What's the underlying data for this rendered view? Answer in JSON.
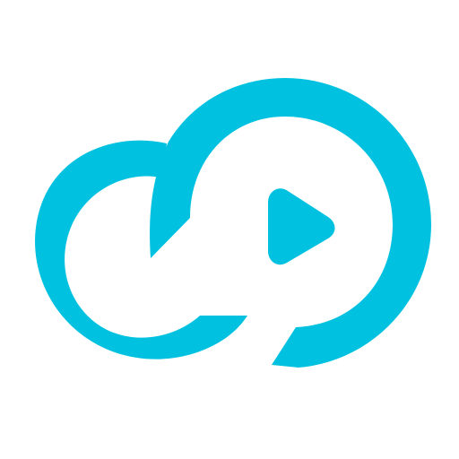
{
  "logo": {
    "icon": "cloud-play-icon",
    "color": "#00C2E0",
    "background": "#FFFFFF"
  }
}
